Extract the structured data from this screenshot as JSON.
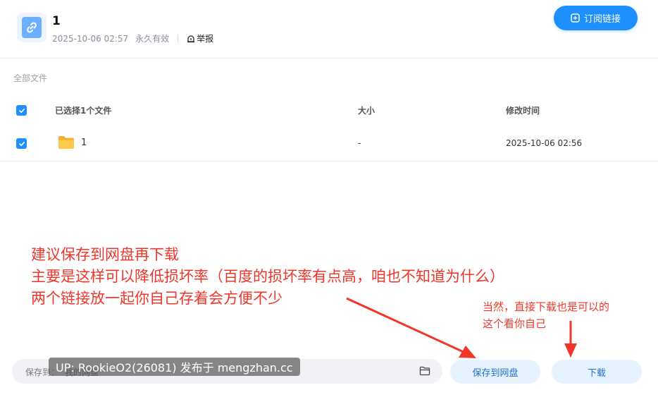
{
  "header": {
    "title": "1",
    "date": "2025-10-06 02:57",
    "validity": "永久有效",
    "report_label": "举报",
    "subscribe_label": "订阅链接"
  },
  "file_list": {
    "breadcrumb": "全部文件",
    "columns": {
      "name": "已选择1个文件",
      "size": "大小",
      "modified": "修改时间"
    },
    "rows": [
      {
        "name": "1",
        "size": "-",
        "modified": "2025-10-06 02:56",
        "checked": true,
        "type": "folder"
      }
    ]
  },
  "annotations": {
    "main_lines": [
      "建议保存到网盘再下载",
      "主要是这样可以降低损坏率（百度的损坏率有点高，咱也不知道为什么）",
      "两个链接放一起你自己存着会方便不少"
    ],
    "side_lines": [
      "当然，直接下载也是可以的",
      "这个看你自己"
    ]
  },
  "footer": {
    "save_to_label": "保存到：",
    "save_to_value": "我的网盘",
    "save_button": "保存到网盘",
    "download_button": "下载"
  },
  "watermark": "UP: RookieO2(26081) 发布于 mengzhan.cc",
  "colors": {
    "accent": "#1e8fff",
    "annotation": "#f0362a",
    "folder": "#ffc53d"
  }
}
